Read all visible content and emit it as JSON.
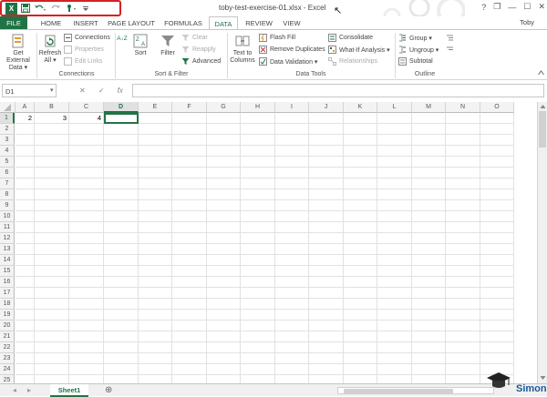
{
  "window": {
    "title": "toby-test-exercise-01.xlsx - Excel",
    "user": "Toby",
    "controls": [
      "?",
      "❐",
      "—",
      "☐",
      "✕"
    ]
  },
  "qat": {
    "icons": [
      "excel-logo",
      "save-icon",
      "undo-icon",
      "redo-icon",
      "touch-mode-icon",
      "customize-qat-icon"
    ]
  },
  "tabs": [
    {
      "label": "FILE"
    },
    {
      "label": "HOME"
    },
    {
      "label": "INSERT"
    },
    {
      "label": "PAGE LAYOUT"
    },
    {
      "label": "FORMULAS"
    },
    {
      "label": "DATA"
    },
    {
      "label": "REVIEW"
    },
    {
      "label": "VIEW"
    }
  ],
  "ribbon": {
    "get_external": {
      "line1": "Get External",
      "line2": "Data ▾"
    },
    "refresh": {
      "line1": "Refresh",
      "line2": "All ▾"
    },
    "connections": "Connections",
    "properties": "Properties",
    "edit_links": "Edit Links",
    "group_connections": "Connections",
    "sort_az": "A↓Z",
    "sort": "Sort",
    "filter": "Filter",
    "clear": "Clear",
    "reapply": "Reapply",
    "advanced": "Advanced",
    "group_sort_filter": "Sort & Filter",
    "text_to_columns": {
      "line1": "Text to",
      "line2": "Columns"
    },
    "flash_fill": "Flash Fill",
    "remove_duplicates": "Remove Duplicates",
    "data_validation": "Data Validation ▾",
    "consolidate": "Consolidate",
    "what_if": "What-If Analysis ▾",
    "relationships": "Relationships",
    "group_data_tools": "Data Tools",
    "group": "Group ▾",
    "ungroup": "Ungroup ▾",
    "subtotal": "Subtotal",
    "group_outline": "Outline"
  },
  "formula_bar": {
    "name_box": "D1",
    "cancel": "✕",
    "enter": "✓",
    "fx": "fx",
    "value": ""
  },
  "sheet": {
    "columns": [
      "A",
      "B",
      "C",
      "D",
      "E",
      "F",
      "G",
      "H",
      "I",
      "J",
      "K",
      "L",
      "M",
      "N",
      "O"
    ],
    "rows": [
      "1",
      "2",
      "3",
      "4",
      "5",
      "6",
      "7",
      "8",
      "9",
      "10",
      "11",
      "12",
      "13",
      "14",
      "15",
      "16",
      "17",
      "18",
      "19",
      "20",
      "21",
      "22",
      "23",
      "24",
      "25"
    ],
    "selected_column": "D",
    "selected_row": "1",
    "cells": {
      "A1": "2",
      "B1": "3",
      "C1": "4"
    },
    "active_cell": "D1"
  },
  "sheet_tabs": {
    "active": "Sheet1",
    "add": "⊕",
    "prev": "◂",
    "next": "▸"
  },
  "watermark": {
    "text": "Simon"
  },
  "colors": {
    "accent": "#217346",
    "highlight_box": "#d42222"
  }
}
